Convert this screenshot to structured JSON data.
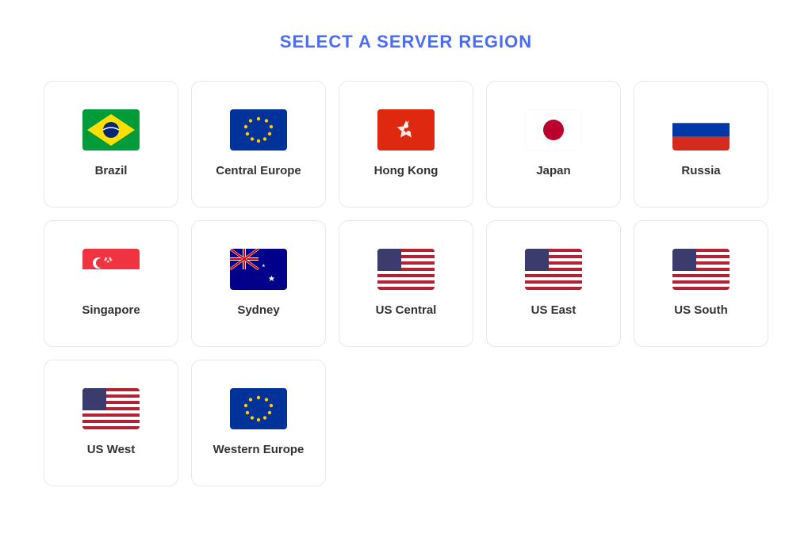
{
  "page": {
    "title": "SELECT A SERVER REGION"
  },
  "regions": [
    {
      "id": "brazil",
      "label": "Brazil",
      "flag": "brazil"
    },
    {
      "id": "central-europe",
      "label": "Central Europe",
      "flag": "eu"
    },
    {
      "id": "hong-kong",
      "label": "Hong Kong",
      "flag": "hk"
    },
    {
      "id": "japan",
      "label": "Japan",
      "flag": "japan"
    },
    {
      "id": "russia",
      "label": "Russia",
      "flag": "russia"
    },
    {
      "id": "singapore",
      "label": "Singapore",
      "flag": "singapore"
    },
    {
      "id": "sydney",
      "label": "Sydney",
      "flag": "australia"
    },
    {
      "id": "us-central",
      "label": "US Central",
      "flag": "us"
    },
    {
      "id": "us-east",
      "label": "US East",
      "flag": "us"
    },
    {
      "id": "us-south",
      "label": "US South",
      "flag": "us"
    },
    {
      "id": "us-west",
      "label": "US West",
      "flag": "us"
    },
    {
      "id": "western-europe",
      "label": "Western Europe",
      "flag": "eu"
    }
  ]
}
